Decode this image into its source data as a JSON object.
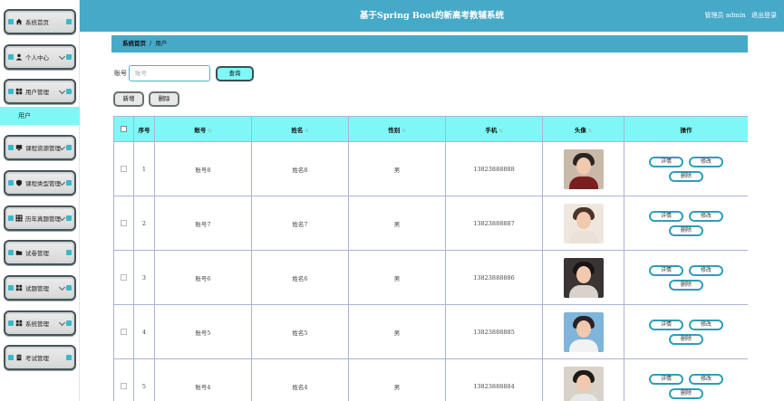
{
  "header": {
    "title": "基于Spring Boot的新高考教辅系统",
    "user_role": "管理员 admin",
    "logout": "退出登录"
  },
  "sidebar": {
    "items": [
      {
        "label": "系统首页",
        "icon": "home-icon",
        "chevron": false
      },
      {
        "label": "个人中心",
        "icon": "person-icon",
        "chevron": true
      },
      {
        "label": "用户管理",
        "icon": "grid-icon",
        "chevron": true
      },
      {
        "label": "课程资源管理",
        "icon": "monitor-icon",
        "chevron": true
      },
      {
        "label": "课程类型管理",
        "icon": "shield-icon",
        "chevron": true
      },
      {
        "label": "历年真题管理",
        "icon": "apps-icon",
        "chevron": true
      },
      {
        "label": "试卷管理",
        "icon": "folder-icon",
        "chevron": false
      },
      {
        "label": "试题管理",
        "icon": "grid-icon",
        "chevron": true
      },
      {
        "label": "系统管理",
        "icon": "grid-icon",
        "chevron": true
      },
      {
        "label": "考试管理",
        "icon": "document-icon",
        "chevron": false
      }
    ],
    "sub_item": "用户"
  },
  "breadcrumb": {
    "home": "系统首页",
    "separator": "/",
    "current": "用户"
  },
  "search": {
    "label": "账号",
    "placeholder": "账号",
    "button": "查询"
  },
  "actions": {
    "add": "新增",
    "delete": "删除"
  },
  "table": {
    "headers": {
      "index": "序号",
      "account": "账号",
      "name": "姓名",
      "gender": "性别",
      "phone": "手机",
      "avatar": "头像",
      "ops": "操作"
    },
    "rows": [
      {
        "index": "1",
        "account": "账号8",
        "name": "姓名8",
        "gender": "男",
        "phone": "13823888888"
      },
      {
        "index": "2",
        "account": "账号7",
        "name": "姓名7",
        "gender": "男",
        "phone": "13823888887"
      },
      {
        "index": "3",
        "account": "账号6",
        "name": "姓名6",
        "gender": "男",
        "phone": "13823888886"
      },
      {
        "index": "4",
        "account": "账号5",
        "name": "姓名5",
        "gender": "男",
        "phone": "13823888885"
      },
      {
        "index": "5",
        "account": "账号4",
        "name": "姓名4",
        "gender": "男",
        "phone": "13823888884"
      }
    ],
    "row_ops": {
      "detail": "详情",
      "edit": "修改",
      "delete": "删除"
    }
  },
  "colors": {
    "accent": "#47a9c8",
    "highlight": "#7ff7f7",
    "button_border": "#2e9fb7"
  }
}
